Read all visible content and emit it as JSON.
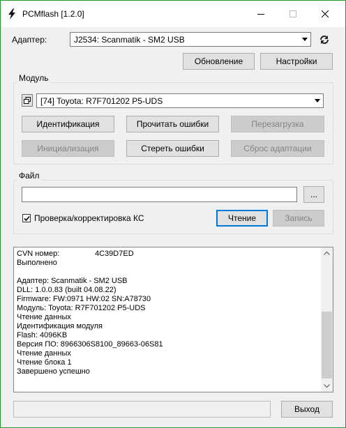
{
  "window": {
    "title": "PCMflash [1.2.0]"
  },
  "titlebar": {
    "minimize_icon": "minimize-icon",
    "maximize_icon": "maximize-icon",
    "close_icon": "close-icon"
  },
  "adapter": {
    "label": "Адаптер:",
    "selected": "J2534: Scanmatik - SM2 USB",
    "refresh_icon": "refresh-icon",
    "update_button": "Обновление",
    "settings_button": "Настройки"
  },
  "module": {
    "group_title": "Модуль",
    "selected": "[74] Toyota: R7F701202 P5-UDS",
    "buttons": {
      "identify": "Идентификация",
      "read_errors": "Прочитать ошибки",
      "reboot": "Перезагрузка",
      "init": "Инициализация",
      "clear_errors": "Стереть ошибки",
      "reset_adapt": "Сброс адаптации"
    }
  },
  "file": {
    "group_title": "Файл",
    "path_value": "",
    "browse_button": "...",
    "checksum_label": "Проверка/корректировка КС",
    "checksum_checked": true,
    "read_button": "Чтение",
    "write_button": "Запись"
  },
  "log": {
    "cvn_label": "CVN номер:",
    "cvn_value": "4C39D7ED",
    "lines": [
      "Выполнено",
      "",
      "Адаптер: Scanmatik - SM2 USB",
      "DLL: 1.0.0.83 (built 04.08.22)",
      "Firmware: FW:0971 HW:02 SN:A78730",
      "Модуль: Toyota: R7F701202 P5-UDS",
      "Чтение данных",
      "Идентификация модуля",
      "Flash: 4096KB",
      "Версия ПО: 8966306S8100_89663-06S81",
      "Чтение данных",
      "Чтение блока 1",
      "Завершено успешно"
    ]
  },
  "footer": {
    "status_text": "",
    "exit_button": "Выход"
  }
}
